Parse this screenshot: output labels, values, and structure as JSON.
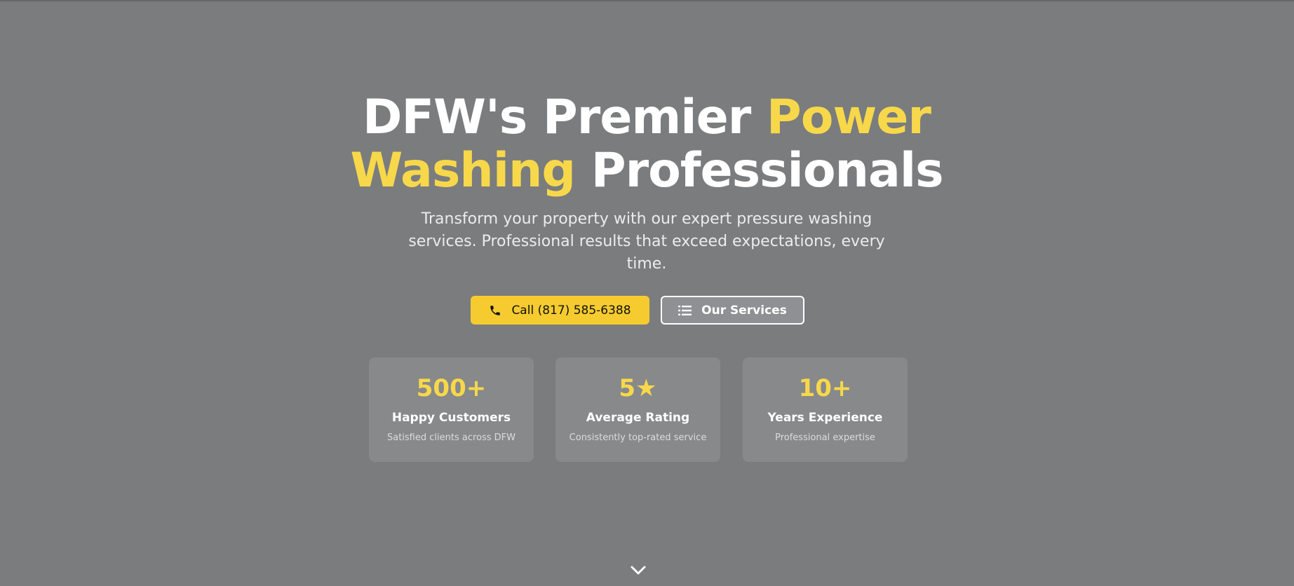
{
  "hero": {
    "headline": {
      "part1": "DFW's Premier ",
      "accent1": "Power",
      "accent2": "Washing",
      "part2": " Professionals"
    },
    "subtitle": "Transform your property with our expert pressure washing services. Professional results that exceed expectations, every time.",
    "buttons": {
      "call": {
        "label": "Call (817) 585-6388",
        "icon": "phone-icon"
      },
      "services": {
        "label": "Our Services",
        "icon": "list-icon"
      }
    },
    "stats": [
      {
        "value": "500+",
        "label": "Happy Customers",
        "description": "Satisfied clients across DFW"
      },
      {
        "value": "5★",
        "label": "Average Rating",
        "description": "Consistently top-rated service"
      },
      {
        "value": "10+",
        "label": "Years Experience",
        "description": "Professional expertise"
      }
    ],
    "scroll_icon": "chevron-down-icon"
  },
  "colors": {
    "background": "#7b7c7e",
    "accent": "#f7d84a",
    "button_primary": "#f5cb2f",
    "text_primary": "#ffffff"
  }
}
